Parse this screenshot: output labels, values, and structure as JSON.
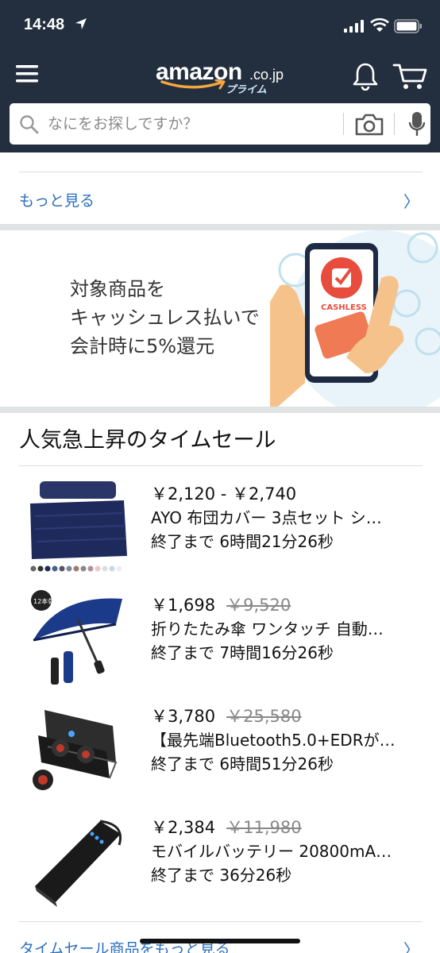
{
  "status_bar": {
    "time": "14:48"
  },
  "header": {
    "logo": {
      "main": "amazon",
      "tld": ".co.jp",
      "sub": "プライム"
    },
    "search": {
      "placeholder": "なにをお探しですか？"
    }
  },
  "more_link": {
    "label": "もっと見る",
    "chevron": "〉"
  },
  "banner": {
    "lines": [
      "対象商品を",
      "キャッシュレス払いで",
      "会計時に5%還元"
    ],
    "badge_text": "CASHLESS"
  },
  "time_sale": {
    "title": "人気急上昇のタイムセール",
    "items": [
      {
        "price": "￥2,120 - ￥2,740",
        "old_price": "",
        "title": "AYO 布団カバー 3点セット シ…",
        "timer": "終了まで 6時間21分26秒"
      },
      {
        "price": "￥1,698",
        "old_price": "￥9,520",
        "title": "折りたたみ傘 ワンタッチ 自動…",
        "timer": "終了まで 7時間16分26秒",
        "image_badge": "12本骨"
      },
      {
        "price": "￥3,780",
        "old_price": "￥25,580",
        "title": "【最先端Bluetooth5.0+EDRが…",
        "timer": "終了まで 6時間51分26秒"
      },
      {
        "price": "￥2,384",
        "old_price": "￥11,980",
        "title": "モバイルバッテリー 20800mA…",
        "timer": "終了まで 36分26秒"
      }
    ],
    "more_label": "タイムセール商品をもっと見る",
    "more_chevron": "〉"
  },
  "colors": {
    "header_bg": "#232f3e",
    "link": "#2a6ebb",
    "amazon_orange": "#f4a740"
  }
}
